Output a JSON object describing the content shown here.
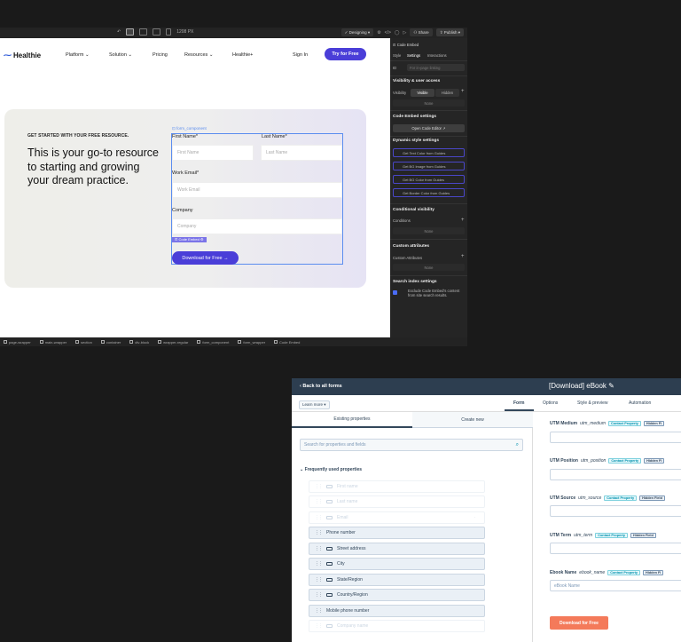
{
  "webflow": {
    "toolbar": {
      "width_label": "1208 PX",
      "mode_label": "Designing",
      "share_label": "Share",
      "publish_label": "Publish"
    },
    "nav": {
      "logo": "Healthie",
      "links": [
        "Platform",
        "Solution",
        "Pricing",
        "Resources",
        "Healthie+"
      ],
      "signin": "Sign In",
      "cta": "Try for Free"
    },
    "hero": {
      "eyebrow": "GET STARTED WITH YOUR FREE RESOURCE.",
      "headline": "This is your go-to resource to starting and growing your dream practice.",
      "form_tag": "form_component",
      "embed_tag": "Code Embed",
      "fields": {
        "first_label": "First Name*",
        "first_placeholder": "First Name",
        "last_label": "Last Name*",
        "last_placeholder": "Last Name",
        "email_label": "Work Email*",
        "email_placeholder": "Work Email",
        "company_label": "Company",
        "company_placeholder": "Company"
      },
      "button": "Download for Free →"
    },
    "panel": {
      "title": "Code Embed",
      "tabs": [
        "Style",
        "Settings",
        "Interactions"
      ],
      "id_label": "ID",
      "id_placeholder": "For in-page linking",
      "visibility_heading": "Visibility & user access",
      "visibility_label": "Visibility",
      "visible": "Visible",
      "hidden": "Hidden",
      "none": "None",
      "embed_heading": "Code Embed settings",
      "open_editor": "Open Code Editor",
      "dynamic_heading": "Dynamic style settings",
      "dynamic_items": [
        "Get Text Color from Guides",
        "Get BG Image from Guides",
        "Get BG Color from Guides",
        "Get Border Color from Guides"
      ],
      "conditional_heading": "Conditional visibility",
      "conditions_label": "Conditions",
      "custom_heading": "Custom attributes",
      "custom_label": "Custom Attributes",
      "search_heading": "Search index settings",
      "exclude_text": "Exclude Code Embed's content from site search results."
    },
    "breadcrumbs": [
      "page-wrapper",
      "main-wrapper",
      "section",
      "container",
      "div-block",
      "wrapper-regular",
      "form_component",
      "form_wrapper",
      "Code Embed"
    ]
  },
  "hubspot": {
    "back": "Back to all forms",
    "title": "[Download] eBook",
    "learn_more": "Learn more",
    "tabs": [
      "Form",
      "Options",
      "Style & preview",
      "Automation"
    ],
    "left_tabs": [
      "Existing properties",
      "Create new"
    ],
    "search_placeholder": "Search for properties and fields",
    "group_title": "Frequently used properties",
    "properties": [
      {
        "label": "First name",
        "state": "dim"
      },
      {
        "label": "Last name",
        "state": "dim"
      },
      {
        "label": "Email",
        "state": "dim"
      },
      {
        "label": "Phone number",
        "state": "act"
      },
      {
        "label": "Street address",
        "state": "act"
      },
      {
        "label": "City",
        "state": "act"
      },
      {
        "label": "State/Region",
        "state": "act"
      },
      {
        "label": "Country/Region",
        "state": "act"
      },
      {
        "label": "Mobile phone number",
        "state": "act"
      },
      {
        "label": "Company name",
        "state": "dim"
      }
    ],
    "fields": [
      {
        "label": "UTM Medium",
        "name": "utm_medium",
        "badge1": "Contact Property",
        "badge2": "Hidden Fi"
      },
      {
        "label": "UTM Position",
        "name": "utm_position",
        "badge1": "Contact Property",
        "badge2": "Hidden Fi"
      },
      {
        "label": "UTM Source",
        "name": "utm_source",
        "badge1": "Contact Property",
        "badge2": "Hidden Field"
      },
      {
        "label": "UTM Term",
        "name": "utm_term",
        "badge1": "Contact Property",
        "badge2": "Hidden Field"
      },
      {
        "label": "Ebook Name",
        "name": "ebook_name",
        "badge1": "Contact Property",
        "badge2": "Hidden Fi",
        "placeholder": "eBook Name"
      }
    ],
    "submit": "Download for Free"
  }
}
